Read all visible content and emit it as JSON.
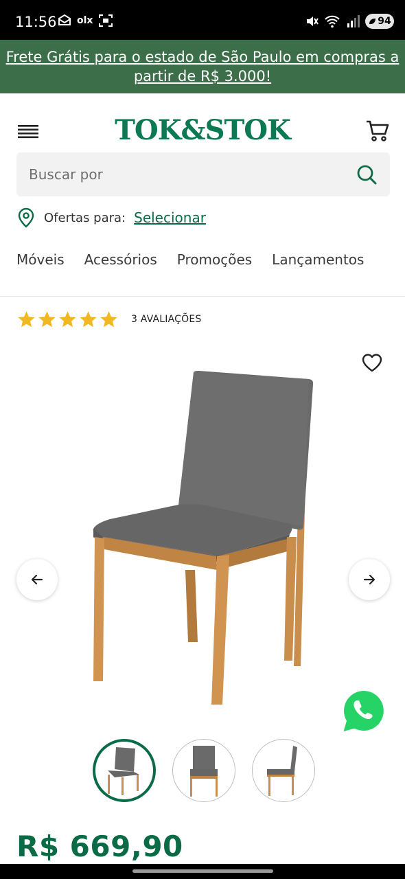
{
  "status_bar": {
    "time": "11:56",
    "left_icons": [
      "mail-stack-icon",
      "olx-icon",
      "screen-capture-icon"
    ],
    "olx_text": "olx",
    "right_icons": [
      "mute-icon",
      "wifi-icon",
      "signal-icon"
    ],
    "battery": "94"
  },
  "promo": {
    "text": "Frete Grátis para o estado de São Paulo em compras a partir de R$ 3.000!"
  },
  "header": {
    "logo": "TOK&STOK",
    "search_placeholder": "Buscar por",
    "offers_label": "Ofertas para:",
    "offers_link": "Selecionar",
    "nav": [
      "Móveis",
      "Acessórios",
      "Promoções",
      "Lançamentos"
    ]
  },
  "product": {
    "rating_stars": 5,
    "reviews_label": "3 AVALIAÇÕES",
    "price": "R$ 669,90",
    "thumbnail_count": 3,
    "active_thumbnail": 1
  },
  "colors": {
    "brand_green": "#0b7a53",
    "promo_bg": "#3c6e4a",
    "star": "#f2b824",
    "whatsapp": "#25d366"
  }
}
